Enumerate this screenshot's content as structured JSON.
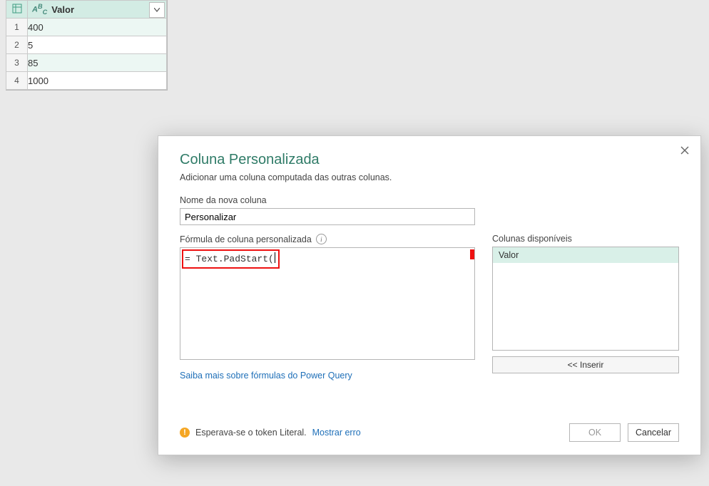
{
  "table": {
    "column_header": "Valor",
    "type_icon": "abc-text-icon",
    "rows": [
      "400",
      "5",
      "85",
      "1000"
    ]
  },
  "dialog": {
    "title": "Coluna Personalizada",
    "subtitle": "Adicionar uma coluna computada das outras colunas.",
    "name_label": "Nome da nova coluna",
    "name_value": "Personalizar",
    "formula_label": "Fórmula de coluna personalizada",
    "formula_prefix": "= ",
    "formula_value": "Text.PadStart(",
    "available_label": "Colunas disponíveis",
    "available_columns": [
      "Valor"
    ],
    "insert_label": "<< Inserir",
    "learn_more": "Saiba mais sobre fórmulas do Power Query",
    "status_text": "Esperava-se o token Literal.",
    "show_error": "Mostrar erro",
    "ok_label": "OK",
    "cancel_label": "Cancelar",
    "colors": {
      "accent": "#2f7b67",
      "highlight": "#e11",
      "warn": "#f5a623"
    }
  }
}
